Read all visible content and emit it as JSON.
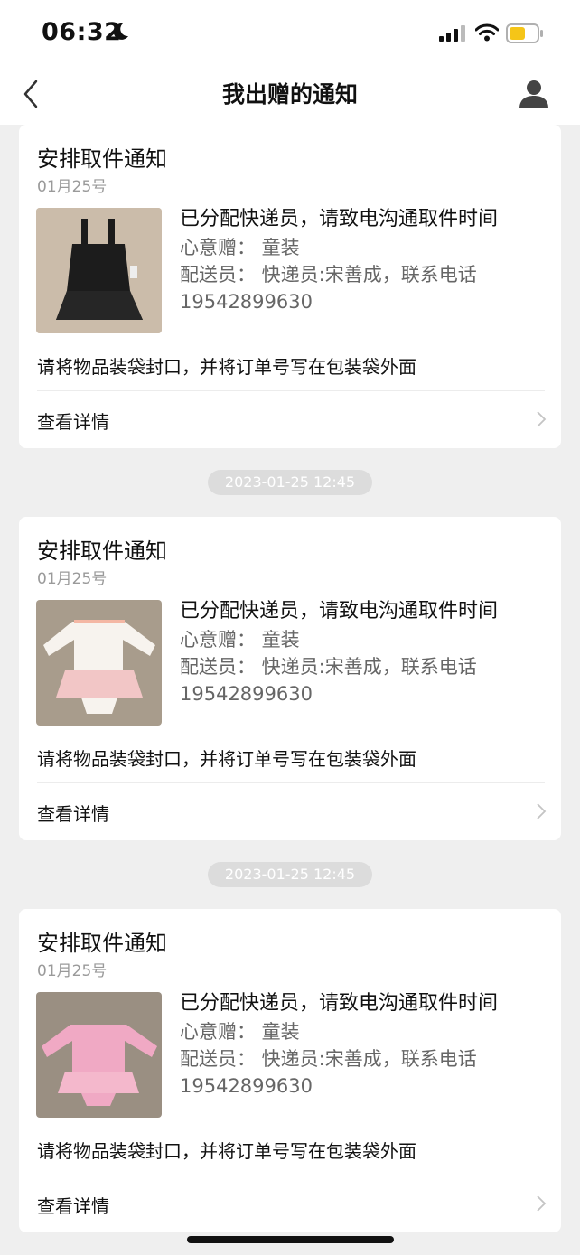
{
  "status_bar": {
    "time": "06:32"
  },
  "header": {
    "title": "我出赠的通知"
  },
  "notifications": [
    {
      "title": "安排取件通知",
      "date": "01月25号",
      "headline": "已分配快递员，请致电沟通取件时间",
      "item_line": "心意赠：  童装",
      "courier_line": "配送员：  快递员:宋善成，联系电话",
      "phone": "19542899630",
      "tip": "请将物品装袋封口，并将订单号写在包装袋外面",
      "detail_label": "查看详情",
      "item_icon": "black-dress-image"
    },
    {
      "title": "安排取件通知",
      "date": "01月25号",
      "headline": "已分配快递员，请致电沟通取件时间",
      "item_line": "心意赠：  童装",
      "courier_line": "配送员：  快递员:宋善成，联系电话",
      "phone": "19542899630",
      "tip": "请将物品装袋封口，并将订单号写在包装袋外面",
      "detail_label": "查看详情",
      "item_icon": "white-tutu-romper-image"
    },
    {
      "title": "安排取件通知",
      "date": "01月25号",
      "headline": "已分配快递员，请致电沟通取件时间",
      "item_line": "心意赠：  童装",
      "courier_line": "配送员：  快递员:宋善成，联系电话",
      "phone": "19542899630",
      "tip": "请将物品装袋封口，并将订单号写在包装袋外面",
      "detail_label": "查看详情",
      "item_icon": "pink-tutu-romper-image"
    }
  ],
  "timestamps": [
    "2023-01-25 12:45",
    "2023-01-25 12:45"
  ]
}
